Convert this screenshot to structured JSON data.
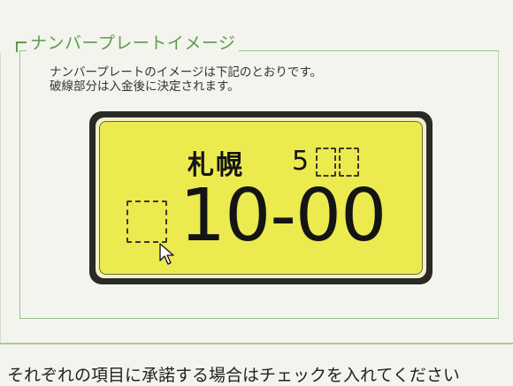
{
  "section": {
    "title": "ナンバープレートイメージ",
    "description_line1": "ナンバープレートのイメージは下記のとおりです。",
    "description_line2": "破線部分は入金後に決定されます。"
  },
  "plate": {
    "region": "札幌",
    "class_number_digit": "5",
    "main_number": "10-00"
  },
  "footer": {
    "text": "それぞれの項目に承諾する場合はチェックを入れてください"
  },
  "colors": {
    "plate_background": "#ebea4f",
    "section_accent": "#5b9b4c"
  },
  "icons": {
    "cursor": "mouse-pointer-icon"
  }
}
